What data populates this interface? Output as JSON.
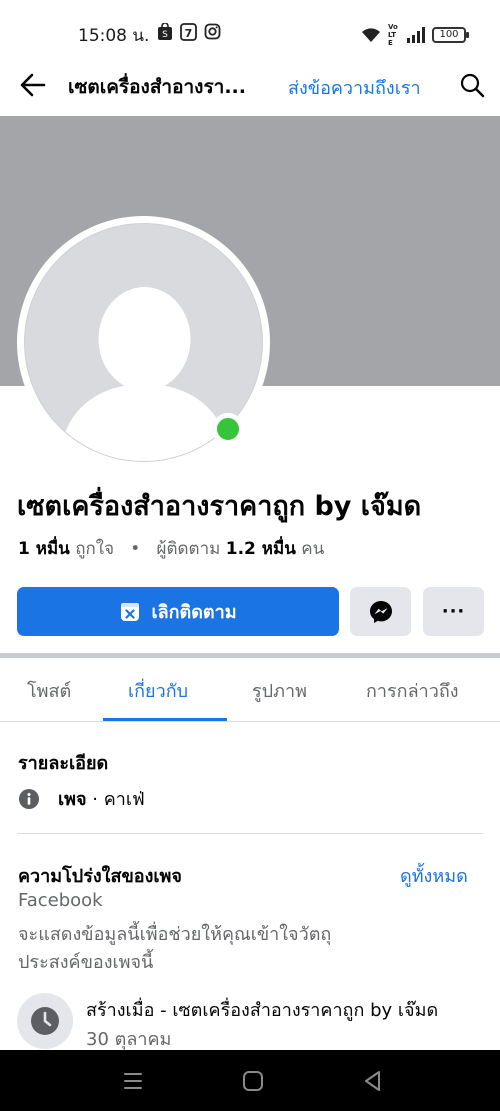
{
  "status_bar": {
    "time": "15:08 น.",
    "battery": "100",
    "volte": "Vo LTE"
  },
  "header": {
    "title": "เซตเครื่องสำอางรา...",
    "message_link": "ส่งข้อความถึงเรา"
  },
  "page": {
    "name": "เซตเครื่องสำอางราคาถูก by เจ๊มด",
    "likes_value": "1 หมื่น",
    "likes_label": "ถูกใจ",
    "separator": "•",
    "followers_label": "ผู้ติดตาม",
    "followers_value": "1.2 หมื่น",
    "followers_unit": "คน"
  },
  "actions": {
    "unfollow_label": "เลิกติดตาม",
    "more_label": "···"
  },
  "tabs": [
    {
      "label": "โพสต์"
    },
    {
      "label": "เกี่ยวกับ",
      "active": true
    },
    {
      "label": "รูปภาพ"
    },
    {
      "label": "การกล่าวถึง"
    }
  ],
  "details": {
    "title": "รายละเอียด",
    "category_bold": "เพจ",
    "category_rest": " · คาเฟ่"
  },
  "transparency": {
    "title": "ความโปร่งใสของเพจ",
    "see_all": "ดูทั้งหมด",
    "source": "Facebook",
    "desc_line1": "จะแสดงข้อมูลนี้เพื่อช่วยให้คุณเข้าใจวัตถุ",
    "desc_line2": "ประสงค์ของเพจนี้",
    "created_title": "สร้างเมื่อ - เซตเครื่องสำอางราคาถูก by เจ๊มด",
    "created_date": "30 ตุลาคม"
  },
  "colors": {
    "accent": "#1b74e4",
    "online": "#36c43b",
    "cover": "#a3a5a9"
  }
}
